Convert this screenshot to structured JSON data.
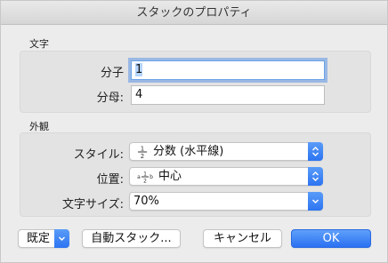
{
  "dialog": {
    "title": "スタックのプロパティ"
  },
  "text_group": {
    "label": "文字",
    "numerator_label": "分子",
    "numerator_value": "1",
    "denominator_label": "分母:",
    "denominator_value": "4"
  },
  "appearance_group": {
    "label": "外観",
    "style_label": "スタイル:",
    "style_value": "分数 (水平線)",
    "position_label": "位置:",
    "position_value": "中心",
    "size_label": "文字サイズ:",
    "size_value": "70%"
  },
  "buttons": {
    "defaults": "既定",
    "auto_stack": "自動スタック...",
    "cancel": "キャンセル",
    "ok": "OK"
  },
  "colors": {
    "accent": "#2c74f2"
  }
}
